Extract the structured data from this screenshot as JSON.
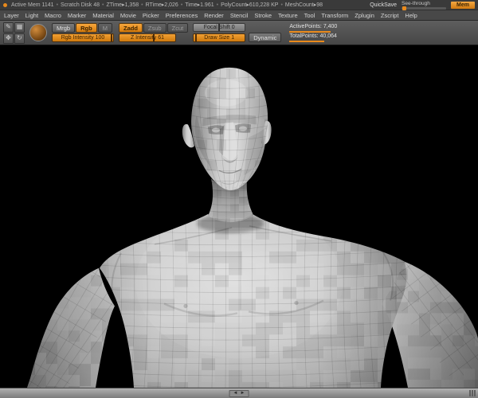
{
  "colors": {
    "accent": "#e98a1c",
    "toolbar_bg": "#4e4e4e",
    "canvas_bg": "#000000",
    "model_gray": "#c4c4c4"
  },
  "status_bar": {
    "items": [
      "Active Mem 1141",
      "Scratch Disk 48",
      "ZTime▸1,358",
      "RTime▸2,026",
      "Time▸1.961",
      "PolyCount▸610,228 KP",
      "MeshCount▸98"
    ],
    "quicksave": "QuickSave",
    "see_through": {
      "label": "See-through",
      "fraction": 0.04
    },
    "mem_button": "Mem"
  },
  "menu_bar": {
    "items": [
      "Layer",
      "Light",
      "Macro",
      "Marker",
      "Material",
      "Movie",
      "Picker",
      "Preferences",
      "Render",
      "Stencil",
      "Stroke",
      "Texture",
      "Tool",
      "Transform",
      "Zplugin",
      "Zscript",
      "Help"
    ]
  },
  "icons": {
    "edit": "✎",
    "draw": "▦",
    "move": "✥",
    "rotate": "↻",
    "scroll_left": "◄",
    "scroll_right": "►"
  },
  "shelf": {
    "mode_buttons": [
      {
        "label": "Mrgb",
        "active": false
      },
      {
        "label": "Rgb",
        "active": true
      },
      {
        "label": "M",
        "active": false
      }
    ],
    "sculpt_buttons": [
      {
        "label": "Zadd",
        "active": true
      },
      {
        "label": "Zsub",
        "active": false
      },
      {
        "label": "Zcut",
        "active": false
      }
    ],
    "rgb_intensity": {
      "label": "Rgb Intensity",
      "value": "100",
      "fraction": 0.97
    },
    "z_intensity": {
      "label": "Z Intensity",
      "value": "61",
      "fraction": 0.61
    },
    "focal_shift": {
      "label": "Focal Shift",
      "value": "0",
      "fraction": 0.5
    },
    "draw_size": {
      "label": "Draw Size",
      "value": "1",
      "fraction": 0.05
    },
    "dynamic_label": "Dynamic",
    "active_points": {
      "label": "ActivePoints:",
      "value": "7,400"
    },
    "total_points": {
      "label": "TotalPoints:",
      "value": "40,064"
    }
  },
  "viewport": {
    "model": "Low-poly male bust"
  }
}
